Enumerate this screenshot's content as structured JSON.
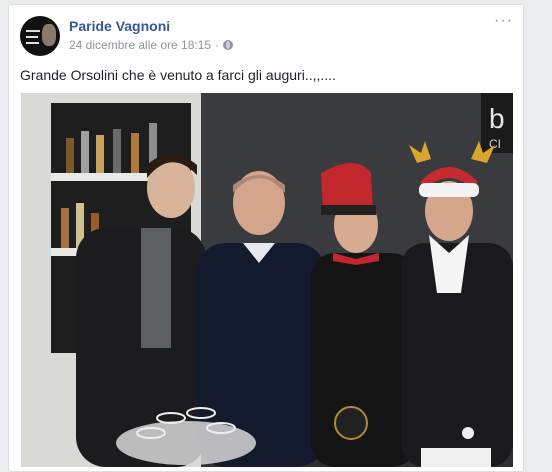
{
  "post": {
    "author": "Paride Vagnoni",
    "timestamp": "24 dicembre alle ore 18:15",
    "separator": "·",
    "privacy_icon": "globe-icon",
    "more_icon": "more-options-icon",
    "more_glyph": "···",
    "message": "Grande Orsolini che è venuto a farci gli auguri..,,....",
    "photo": {
      "sign_text_1": "b",
      "sign_text_2": "CI"
    }
  },
  "colors": {
    "author": "#365899",
    "meta": "#90949c",
    "text": "#1d2129",
    "background": "#e9ebee"
  }
}
